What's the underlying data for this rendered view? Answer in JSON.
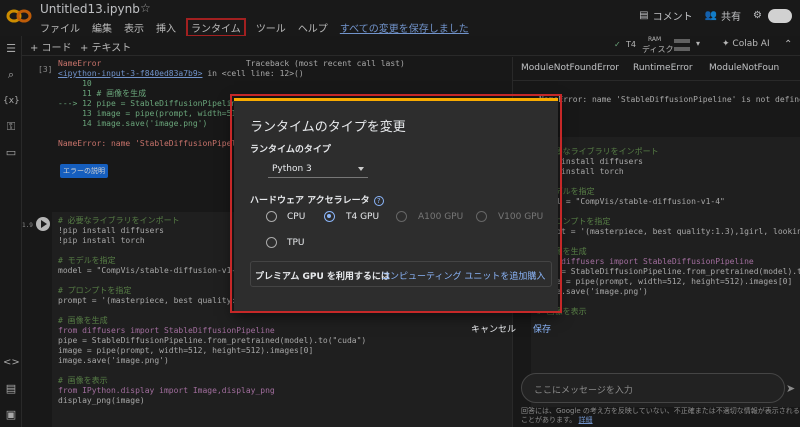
{
  "header": {
    "title": "Untitled13.ipynb",
    "menu": [
      "ファイル",
      "編集",
      "表示",
      "挿入",
      "ランタイム",
      "ツール",
      "ヘルプ"
    ],
    "saved_text": "すべての変更を保存しました",
    "comment": "コメント",
    "share": "共有"
  },
  "toolbar": {
    "add_code": "+ コード",
    "add_text": "+ テキスト",
    "gpu": "T4",
    "ram": "RAM",
    "disk": "ディスク",
    "colab_ai": "Colab AI"
  },
  "cell1": {
    "exec_count": "[3]",
    "err_name": "NameError",
    "traceback": "Traceback (most recent call last)",
    "link": "<ipython-input-3-f840ed83a7b9>",
    "link_suffix": " in <cell line: 12>()",
    "l10": "     10",
    "l11": "     11 # 画像を生成",
    "l12": "---> 12 pipe = StableDiffusionPipeline.from_pretrained(model).to(\"cuda\")",
    "l13": "     13 image = pipe(prompt, width=512, height=512).images[0]",
    "l14": "     14 image.save('image.png')",
    "err_msg": "NameError: name 'StableDiffusionPipeline' is not defined",
    "explain_btn": "エラーの説明"
  },
  "cell2": {
    "exec_count": "1.9",
    "lines": [
      "# 必要なライブラリをインポート",
      "!pip install diffusers",
      "!pip install torch",
      "",
      "# モデルを指定",
      "model = \"CompVis/stable-diffusion-v1-4\"",
      "",
      "# プロンプトを指定",
      "prompt = '(masterpiece, best quality:1.3),1girl, looking up from down, smile, long hair, blue eyes, blonde hair, whi",
      "",
      "# 画像を生成",
      "from diffusers import StableDiffusionPipeline",
      "pipe = StableDiffusionPipeline.from_pretrained(model).to(\"cuda\")",
      "image = pipe(prompt, width=512, height=512).images[0]",
      "image.save('image.png')",
      "",
      "# 画像を表示",
      "from IPython.display import Image,display_png",
      "display_png(image)"
    ]
  },
  "right_panel": {
    "tabs": [
      "ModuleNotFoundError",
      "RuntimeError",
      "ModuleNotFoun"
    ],
    "error_line": "NameError: name 'StableDiffusionPipeline' is not defined",
    "code": [
      "# 必要なライブラリをインポート",
      "!pip install diffusers",
      "!pip install torch",
      "",
      "# モデルを指定",
      "model = \"CompVis/stable-diffusion-v1-4\"",
      "",
      "# プロンプトを指定",
      "prompt = '(masterpiece, best quality:1.3),1girl, looking up fr",
      "",
      "# 画像を生成",
      "from diffusers import StableDiffusionPipeline",
      "pipe = StableDiffusionPipeline.from_pretrained(model).to(\"cuda",
      "image = pipe(prompt, width=512, height=512).images[0]",
      "image.save('image.png')",
      "",
      "# 画像を表示"
    ],
    "chat_placeholder": "ここにメッセージを入力",
    "disclaimer": "回答には、Google の考え方を反映していない、不正確または不適切な情報が表示されることがあります。",
    "disclaimer_link": "詳細"
  },
  "dialog": {
    "title": "ランタイムのタイプを変更",
    "runtime_type_label": "ランタイムのタイプ",
    "runtime_value": "Python 3",
    "accelerator_label": "ハードウェア アクセラレータ",
    "options": [
      {
        "label": "CPU",
        "selected": false,
        "disabled": false
      },
      {
        "label": "T4 GPU",
        "selected": true,
        "disabled": false
      },
      {
        "label": "A100 GPU",
        "selected": false,
        "disabled": true
      },
      {
        "label": "V100 GPU",
        "selected": false,
        "disabled": true
      },
      {
        "label": "TPU",
        "selected": false,
        "disabled": false
      }
    ],
    "premium_text": "プレミアム GPU を利用するには",
    "premium_link": "コンピューティング ユニットを追加購入",
    "cancel": "キャンセル",
    "save": "保存"
  },
  "colors": {
    "accent": "#8ab4f8",
    "highlight": "#c62828",
    "dialog_top": "#f9ab00"
  }
}
